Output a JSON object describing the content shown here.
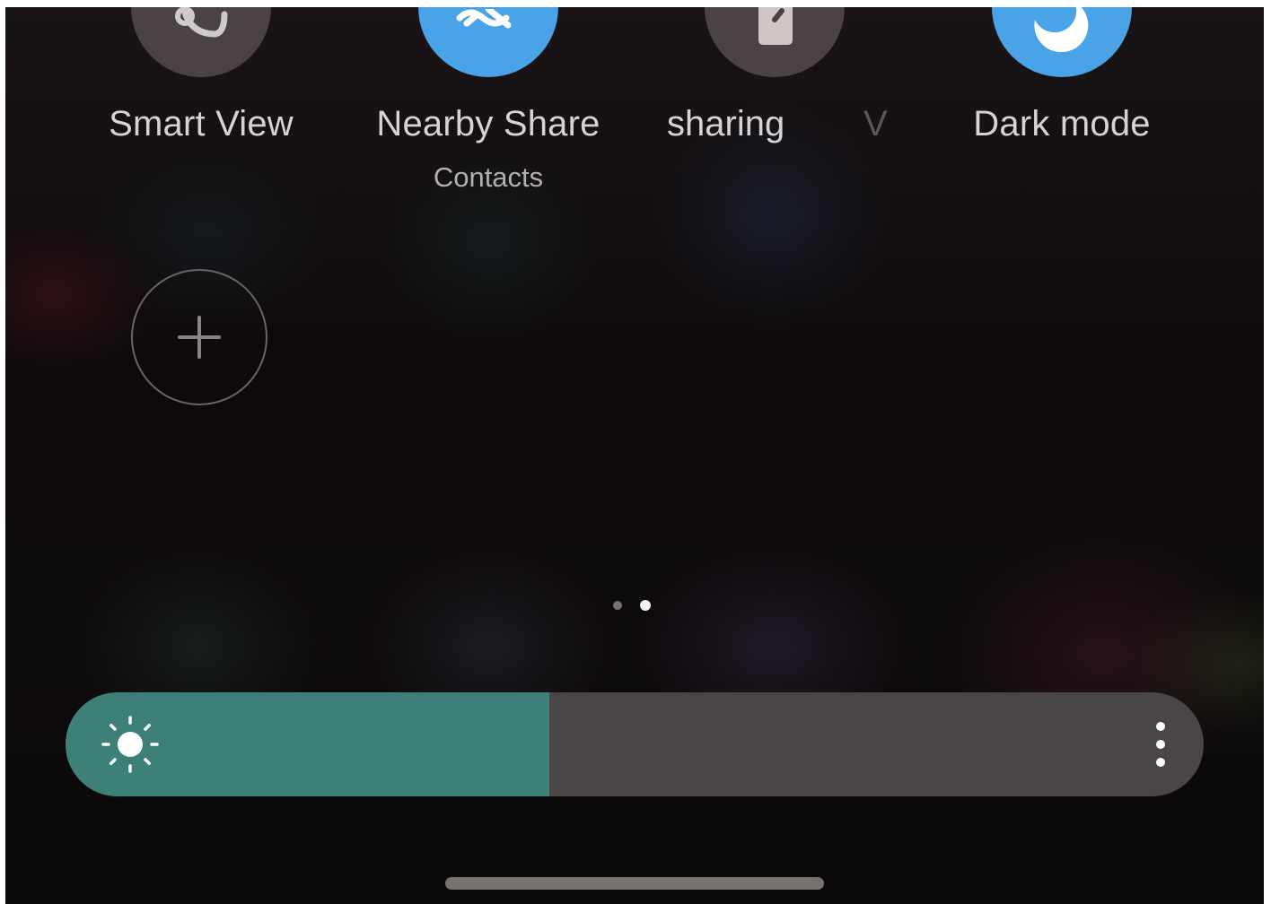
{
  "quick_panel": {
    "tiles": [
      {
        "label": "Smart View",
        "state": "off",
        "icon": "smart-view-icon"
      },
      {
        "label": "Nearby Share",
        "sublabel": "Contacts",
        "state": "on",
        "icon": "nearby-share-icon"
      },
      {
        "label": "sharing",
        "state": "off",
        "icon": "screen-sharing-icon"
      },
      {
        "label": "V",
        "state": "off"
      },
      {
        "label": "Dark mode",
        "state": "on",
        "icon": "moon-icon"
      }
    ],
    "add_button_icon": "plus-icon"
  },
  "pager": {
    "page_count": 2,
    "current_page": 2
  },
  "brightness": {
    "level": 0.425,
    "icon": "sun-icon",
    "menu_icon": "more-vertical-icon"
  },
  "colors": {
    "tile_on": "#4aa3e6",
    "tile_off": "#4a4244",
    "brightness_fill": "#3c8079",
    "brightness_track": "#4a4546"
  }
}
